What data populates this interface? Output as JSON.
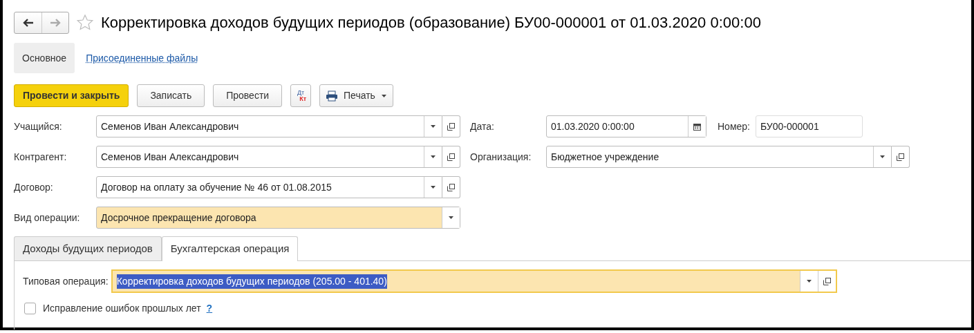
{
  "window": {
    "title": "Корректировка доходов будущих периодов (образование) БУ00-000001 от 01.03.2020 0:00:00",
    "favorite": false
  },
  "nav": [
    {
      "kind": "back",
      "disabled": false
    },
    {
      "kind": "forward",
      "disabled": true
    }
  ],
  "sections": [
    {
      "label": "Основное",
      "selected": true
    },
    {
      "label": "Присоединенные файлы",
      "selected": false
    }
  ],
  "toolbar": [
    {
      "kind": "primary",
      "label": "Провести и закрыть"
    },
    {
      "kind": "plain",
      "label": "Записать"
    },
    {
      "kind": "plain",
      "label": "Провести"
    },
    {
      "kind": "dtkt",
      "label": "Дт",
      "sublabel": "Кт"
    },
    {
      "kind": "menu",
      "label": "Печать"
    }
  ],
  "left_fields": [
    {
      "label": "Учащийся:",
      "value": "Семенов Иван Александрович",
      "kind": "select-open",
      "highlighted": false
    },
    {
      "label": "Контрагент:",
      "value": "Семенов Иван Александрович",
      "kind": "select-open",
      "highlighted": false
    },
    {
      "label": "Договор:",
      "value": "Договор на оплату за обучение № 46 от 01.08.2015",
      "kind": "select-open",
      "highlighted": false
    },
    {
      "label": "Вид операции:",
      "value": "Досрочное прекращение договора",
      "kind": "select",
      "highlighted": true
    }
  ],
  "right_fields": [
    {
      "label": "Дата:",
      "value": "01.03.2020  0:00:00",
      "kind": "date",
      "number_label": "Номер:",
      "number_value": "БУ00-000001"
    },
    {
      "label": "Организация:",
      "value": "Бюджетное учреждение",
      "kind": "select-open"
    }
  ],
  "tabs": [
    {
      "label": "Доходы будущих периодов",
      "selected": false
    },
    {
      "label": "Бухгалтерская операция",
      "selected": true
    }
  ],
  "typical_operation": {
    "label": "Типовая операция:",
    "value": "Корректировка доходов будущих периодов (205.00 - 401.40)",
    "focused": true,
    "text_selected": true
  },
  "fix_errors": {
    "label": "Исправление ошибок прошлых лет",
    "checked": false,
    "help": "?"
  }
}
